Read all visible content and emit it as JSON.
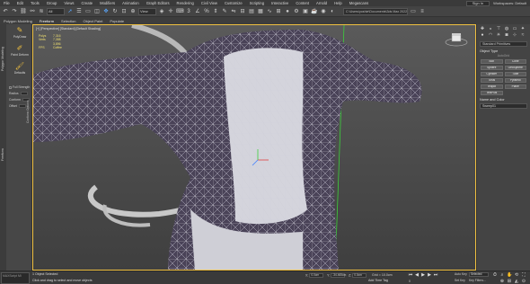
{
  "menubar": {
    "items": [
      "File",
      "Edit",
      "Tools",
      "Group",
      "Views",
      "Create",
      "Modifiers",
      "Animation",
      "Graph Editors",
      "Rendering",
      "Civil View",
      "Customize",
      "Scripting",
      "Interactive",
      "Content",
      "Arnold",
      "Help",
      "Megascans"
    ],
    "sign_in": "Sign In",
    "workspace": "Workspaces: Default"
  },
  "toolbar": {
    "selection_filter": "All",
    "view_dropdown": "View",
    "path_field": "C:\\Users\\yoshie\\Documents\\3ds Max 2022\\"
  },
  "ribbon": {
    "tabs": [
      "Polygon Modeling",
      "Freeform",
      "Selection",
      "Object Paint",
      "Populate"
    ],
    "active_index": 1
  },
  "leftpanel": {
    "tabs": [
      "Polygon Modeling",
      "Freeform"
    ],
    "tools": [
      {
        "icon": "pencil-icon",
        "label": "PolyDraw"
      },
      {
        "icon": "paint-icon",
        "label": "Paint Deform"
      },
      {
        "icon": "brush-icon",
        "label": "Defaults"
      }
    ],
    "params": [
      {
        "label": "Full Strength",
        "value": ""
      },
      {
        "label": "Radius",
        "value": ""
      },
      {
        "label": "Conform",
        "value": ""
      },
      {
        "label": "Offset",
        "value": ""
      }
    ],
    "side_tab": "Conform Options"
  },
  "viewport": {
    "label": "[+] [Perspective] [Standard] [Default Shading]",
    "stats": [
      {
        "key": "Polys",
        "value": "7,316"
      },
      {
        "key": "Verts",
        "value": "7,358"
      },
      {
        "key": "",
        "value": "3,896"
      },
      {
        "key": "FPS",
        "value": "Coffee"
      }
    ]
  },
  "cmdpanel": {
    "category_dropdown": "Standard Primitives",
    "object_type_title": "Object Type",
    "autogrid_label": "AutoGrid",
    "buttons": [
      "Box",
      "Cone",
      "Sphere",
      "GeoSphere",
      "Cylinder",
      "Tube",
      "Torus",
      "Pyramid",
      "Teapot",
      "Plane",
      "TextPlus"
    ],
    "name_color_title": "Name and Color",
    "name_value": "Sweep01"
  },
  "statusbar": {
    "maxscript": "MAXScript Mi",
    "line1": "1 Object Selected",
    "line2": "Click and drag to select and move objects",
    "x_label": "X:",
    "x_value": "0.0cm",
    "y_label": "Y:",
    "y_value": "-34.465cm",
    "z_label": "Z:",
    "z_value": "0.0cm",
    "grid_label": "Grid = 10.0cm",
    "add_time_tag": "Add Time Tag",
    "auto_key": "Auto Key",
    "selected_label": "Selected",
    "set_key": "Set Key",
    "key_filters": "Key Filters...",
    "frame_value": "0"
  }
}
